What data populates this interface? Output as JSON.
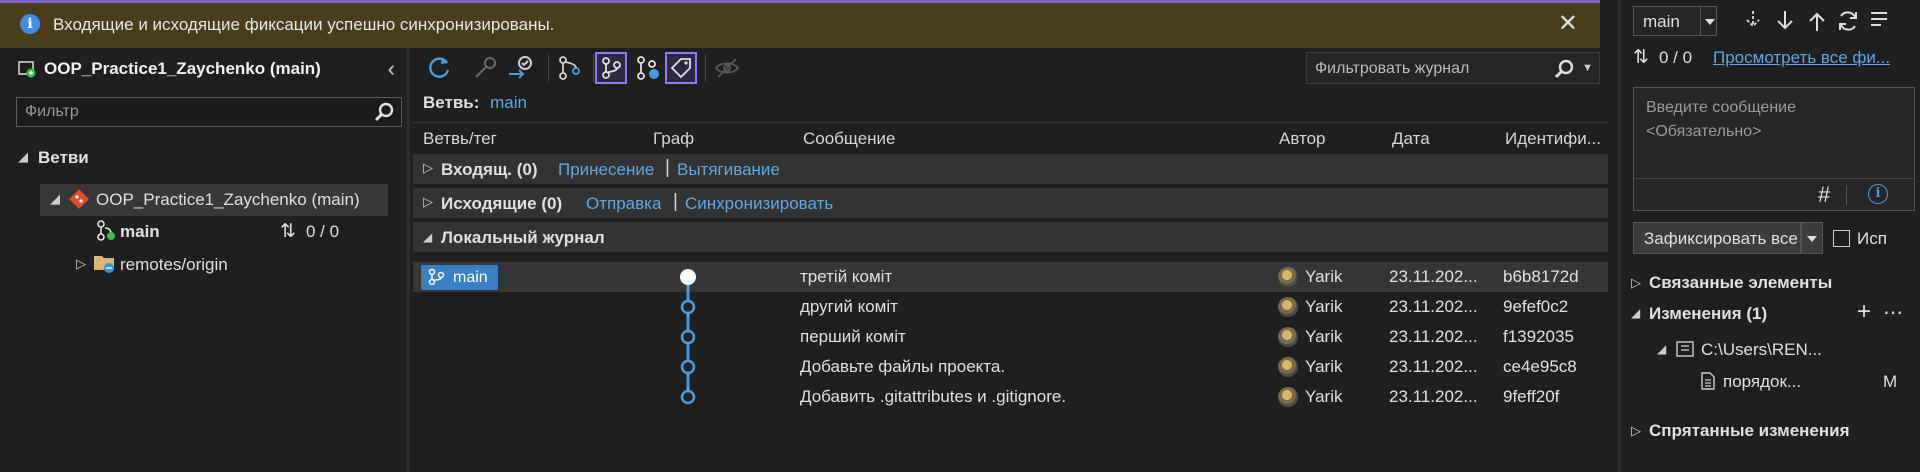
{
  "notification": {
    "message": "Входящие и исходящие фиксации успешно синхронизированы.",
    "close_glyph": "✕"
  },
  "left": {
    "repo_title": "OOP_Practice1_Zaychenko (main)",
    "filter_placeholder": "Фильтр",
    "branches_label": "Ветви",
    "repo_node": "OOP_Practice1_Zaychenko (main)",
    "main_branch": "main",
    "sync_counts": "0 / 0",
    "remotes": "remotes/origin"
  },
  "toolbar": {
    "journal_filter_placeholder": "Фильтровать журнал"
  },
  "branch": {
    "label": "Ветвь:",
    "value": "main"
  },
  "columns": {
    "branch_tag": "Ветвь/тег",
    "graph": "Граф",
    "message": "Сообщение",
    "author": "Автор",
    "date": "Дата",
    "id": "Идентифи..."
  },
  "incoming": {
    "label": "Входящ. (0)",
    "fetch": "Принесение",
    "pull": "Вытягивание"
  },
  "outgoing": {
    "label": "Исходящие (0)",
    "push": "Отправка",
    "sync": "Синхронизировать"
  },
  "local_history": {
    "label": "Локальный журнал",
    "branch_tag": "main"
  },
  "commits": [
    {
      "message": "третій коміт",
      "author": "Yarik",
      "date": "23.11.202...",
      "hash": "b6b8172d"
    },
    {
      "message": "другий коміт",
      "author": "Yarik",
      "date": "23.11.202...",
      "hash": "9efef0c2"
    },
    {
      "message": "перший коміт",
      "author": "Yarik",
      "date": "23.11.202...",
      "hash": "f1392035"
    },
    {
      "message": "Добавьте файлы проекта.",
      "author": "Yarik",
      "date": "23.11.202...",
      "hash": "ce4e95c8"
    },
    {
      "message": "Добавить .gitattributes и .gitignore.",
      "author": "Yarik",
      "date": "23.11.202...",
      "hash": "9feff20f"
    }
  ],
  "right": {
    "branch_select": "main",
    "sync_counts": "0 / 0",
    "view_all": "Просмотреть все фи...",
    "message_placeholder": "Введите сообщение <Обязательно>",
    "commit_all": "Зафиксировать все",
    "amend_label": "Исп",
    "related_items": "Связанные элементы",
    "changes": "Изменения (1)",
    "path": "C:\\Users\\REN...",
    "file": "порядок...",
    "file_status": "M",
    "stashes": "Спрятанные изменения"
  },
  "colors": {
    "accent": "#8a7cff",
    "link": "#5fa8e8",
    "graph": "#4a9de0",
    "notification_bg": "#4a3d1c"
  }
}
